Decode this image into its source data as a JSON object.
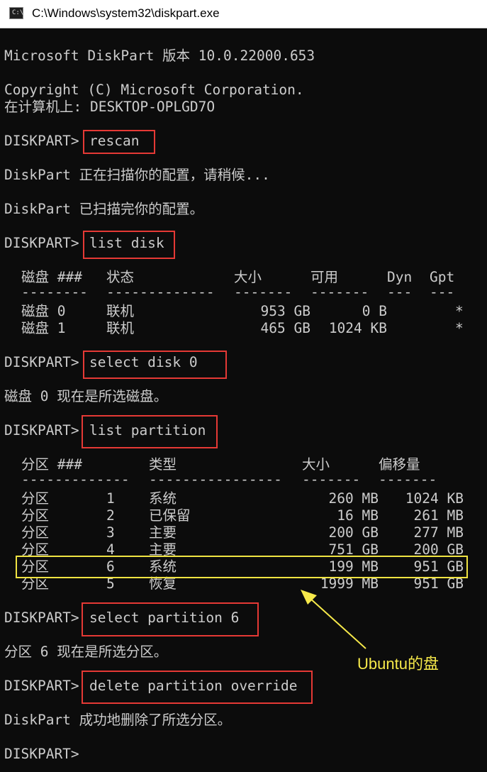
{
  "window": {
    "title": "C:\\Windows\\system32\\diskpart.exe",
    "icon": "terminal-icon"
  },
  "console": {
    "version": "Microsoft DiskPart 版本 10.0.22000.653",
    "copyright": "Copyright (C) Microsoft Corporation.",
    "computer": "在计算机上: DESKTOP-OPLGD7O",
    "prompt": "DISKPART>",
    "cmd_rescan": "rescan",
    "scanning": "DiskPart 正在扫描你的配置，请稍候...",
    "scanned": "DiskPart 已扫描完你的配置。",
    "cmd_list_disk": "list disk",
    "cmd_select_disk": "select disk 0",
    "disk_selected": "磁盘 0 现在是所选磁盘。",
    "cmd_list_partition": "list partition",
    "cmd_select_partition": "select partition 6",
    "partition_selected": "分区 6 现在是所选分区。",
    "cmd_delete": "delete partition override",
    "deleted": "DiskPart 成功地删除了所选分区。"
  },
  "disk_table": {
    "headers": [
      "磁盘 ###",
      "状态",
      "大小",
      "可用",
      "Dyn",
      "Gpt"
    ],
    "dashes": [
      "--------",
      "-------------",
      "-------",
      "-------",
      "---",
      "---"
    ],
    "rows": [
      {
        "name": "磁盘 0",
        "status": "联机",
        "size": "953 GB",
        "free": "0 B",
        "dyn": "",
        "gpt": "*"
      },
      {
        "name": "磁盘 1",
        "status": "联机",
        "size": "465 GB",
        "free": "1024 KB",
        "dyn": "",
        "gpt": "*"
      }
    ]
  },
  "partition_table": {
    "headers": [
      "分区 ###",
      "类型",
      "大小",
      "偏移量"
    ],
    "dashes": [
      "-------------",
      "----------------",
      "-------",
      "-------"
    ],
    "rows": [
      {
        "label": "分区",
        "num": "1",
        "type": "系统",
        "size": "260 MB",
        "offset": "1024 KB"
      },
      {
        "label": "分区",
        "num": "2",
        "type": "已保留",
        "size": "16 MB",
        "offset": "261 MB"
      },
      {
        "label": "分区",
        "num": "3",
        "type": "主要",
        "size": "200 GB",
        "offset": "277 MB"
      },
      {
        "label": "分区",
        "num": "4",
        "type": "主要",
        "size": "751 GB",
        "offset": "200 GB"
      },
      {
        "label": "分区",
        "num": "6",
        "type": "系统",
        "size": "199 MB",
        "offset": "951 GB"
      },
      {
        "label": "分区",
        "num": "5",
        "type": "恢复",
        "size": "1999 MB",
        "offset": "951 GB"
      }
    ]
  },
  "annotation": {
    "text": "Ubuntu的盘",
    "highlight_color": "#f0e442",
    "box_color": "#e53935"
  }
}
